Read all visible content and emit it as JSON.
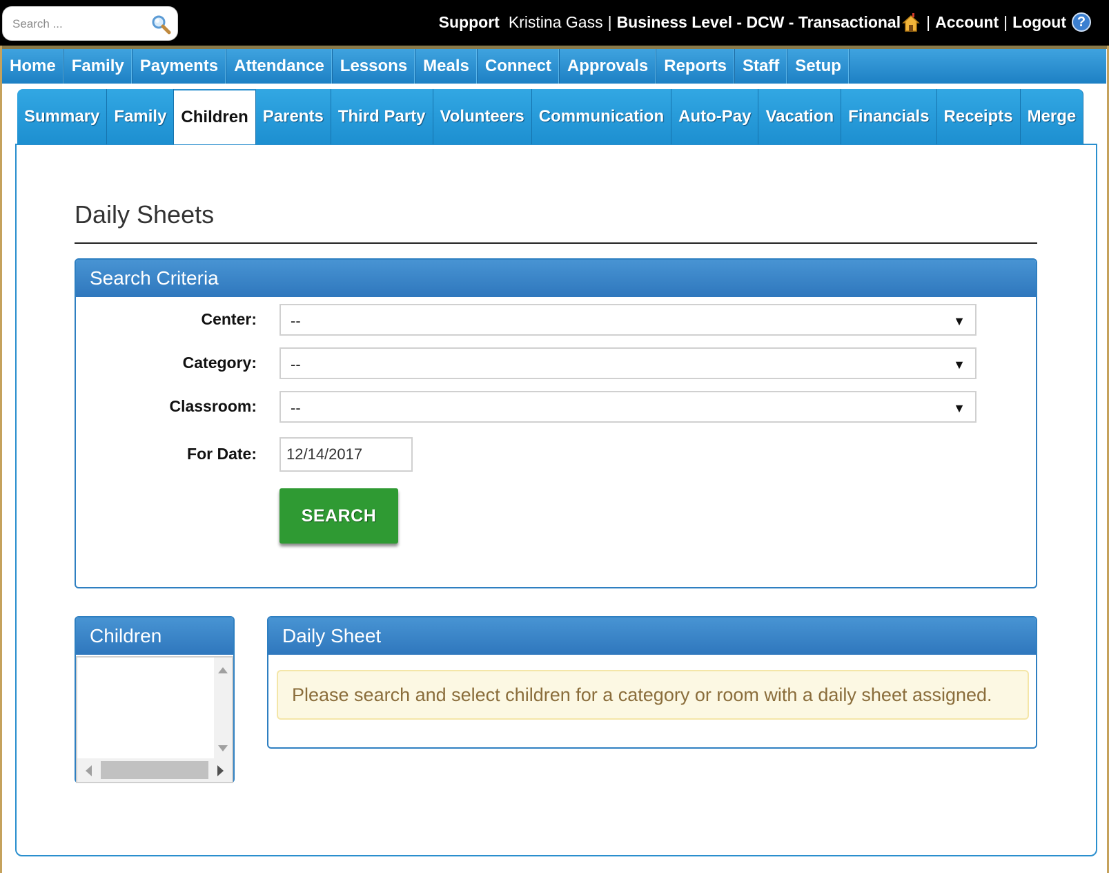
{
  "search": {
    "placeholder": "Search ..."
  },
  "header": {
    "support_label": "Support",
    "user_name": "Kristina Gass",
    "separator": "|",
    "level_label": "Business Level - DCW - Transactional",
    "account_label": "Account",
    "logout_label": "Logout",
    "help_glyph": "?"
  },
  "main_nav": [
    {
      "label": "Home"
    },
    {
      "label": "Family"
    },
    {
      "label": "Payments"
    },
    {
      "label": "Attendance"
    },
    {
      "label": "Lessons"
    },
    {
      "label": "Meals"
    },
    {
      "label": "Connect"
    },
    {
      "label": "Approvals"
    },
    {
      "label": "Reports"
    },
    {
      "label": "Staff"
    },
    {
      "label": "Setup"
    }
  ],
  "sub_tabs": [
    {
      "label": "Summary"
    },
    {
      "label": "Family"
    },
    {
      "label": "Children",
      "active": true
    },
    {
      "label": "Parents"
    },
    {
      "label": "Third Party"
    },
    {
      "label": "Volunteers"
    },
    {
      "label": "Communication"
    },
    {
      "label": "Auto-Pay"
    },
    {
      "label": "Vacation"
    },
    {
      "label": "Financials"
    },
    {
      "label": "Receipts"
    },
    {
      "label": "Merge"
    }
  ],
  "page": {
    "title": "Daily Sheets"
  },
  "search_criteria": {
    "heading": "Search Criteria",
    "center": {
      "label": "Center:",
      "value": "--"
    },
    "category": {
      "label": "Category:",
      "value": "--"
    },
    "classroom": {
      "label": "Classroom:",
      "value": "--"
    },
    "for_date": {
      "label": "For Date:",
      "value": "12/14/2017"
    },
    "search_button": "SEARCH"
  },
  "children_panel": {
    "heading": "Children"
  },
  "daily_sheet_panel": {
    "heading": "Daily Sheet",
    "message": "Please search and select children for a category or room with a daily sheet assigned."
  },
  "colors": {
    "top_bar": "#000000",
    "nav_blue": "#2a8fce",
    "panel_head": "#3a85c8",
    "search_button": "#2f9a33",
    "alert_bg": "#fcf8e3",
    "alert_text": "#8a6d3b"
  },
  "icons": {
    "search": "magnifier-icon",
    "home": "house-icon",
    "help": "question-circle-icon"
  }
}
